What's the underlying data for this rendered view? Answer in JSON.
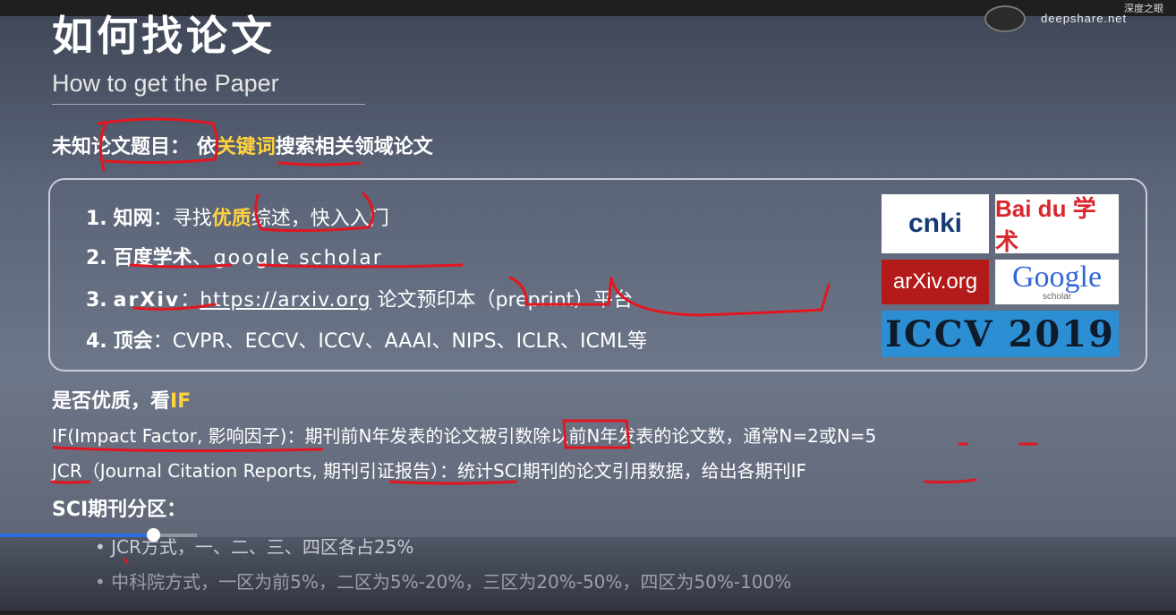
{
  "watermark": {
    "text": "deepshare.net",
    "top_text": "深度之眼"
  },
  "slide": {
    "title": "如何找论文",
    "subtitle": "How to get the Paper",
    "h1_part1": "未知论文题目：",
    "h1_part2": "依",
    "h1_part3": "关键词",
    "h1_part4": "搜索相关领域论文",
    "items": [
      {
        "n": "1.",
        "label": "知网",
        "text_a": "：寻找",
        "hl": "优质",
        "text_b": "综述，快入入门"
      },
      {
        "n": "2.",
        "label": "百度学术",
        "text_a": "、google scholar"
      },
      {
        "n": "3.",
        "label": "arXiv",
        "text_a": "：",
        "url": "https://arxiv.org",
        "text_b": " 论文预印本（preprint）平台"
      },
      {
        "n": "4.",
        "label": "顶会",
        "text_a": "：CVPR、ECCV、ICCV、AAAI、NIPS、ICLR、ICML等"
      }
    ],
    "logos": {
      "cnki": "cnki",
      "baidu": "Bai du 学术",
      "arxiv": "arXiv.org",
      "google": "Google",
      "google_sub": "scholar",
      "iccv": "ICCV 2019"
    },
    "h2_part1": "是否优质，看",
    "h2_part2": "IF",
    "p1": "IF(Impact Factor, 影响因子)：期刊前N年发表的论文被引数除以前N年发表的论文数，通常N=2或N=5",
    "p2": "JCR（Journal Citation Reports, 期刊引证报告）：统计SCI期刊的论文引用数据，给出各期刊IF",
    "h3": "SCI期刊分区：",
    "bullets": [
      "•   JCR方式，一、二、三、四区各占25%",
      "•   中科院方式，一区为前5%，二区为5%-20%，三区为20%-50%，四区为50%-100%"
    ]
  },
  "video": {
    "progress": 0.13
  }
}
